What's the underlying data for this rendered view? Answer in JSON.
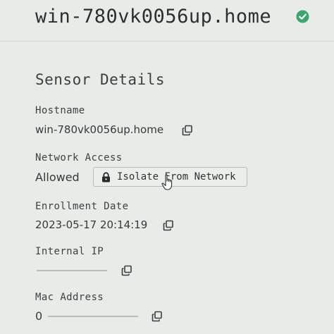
{
  "header": {
    "hostname_title": "win-780vk0056up.home",
    "status_icon": "check-circle-icon",
    "status_color": "#3aa76d"
  },
  "details": {
    "section_title": "Sensor Details",
    "hostname": {
      "label": "Hostname",
      "value": "win-780vk0056up.home",
      "copy_icon": "copy-icon"
    },
    "network_access": {
      "label": "Network Access",
      "value": "Allowed",
      "action_label": "Isolate From Network",
      "action_icon": "lock-icon"
    },
    "enrollment_date": {
      "label": "Enrollment Date",
      "value": "2023-05-17 20:14:19",
      "copy_icon": "copy-icon"
    },
    "internal_ip": {
      "label": "Internal IP",
      "value": "",
      "copy_icon": "copy-icon"
    },
    "mac_address": {
      "label": "Mac Address",
      "value": "0",
      "copy_icon": "copy-icon"
    }
  }
}
